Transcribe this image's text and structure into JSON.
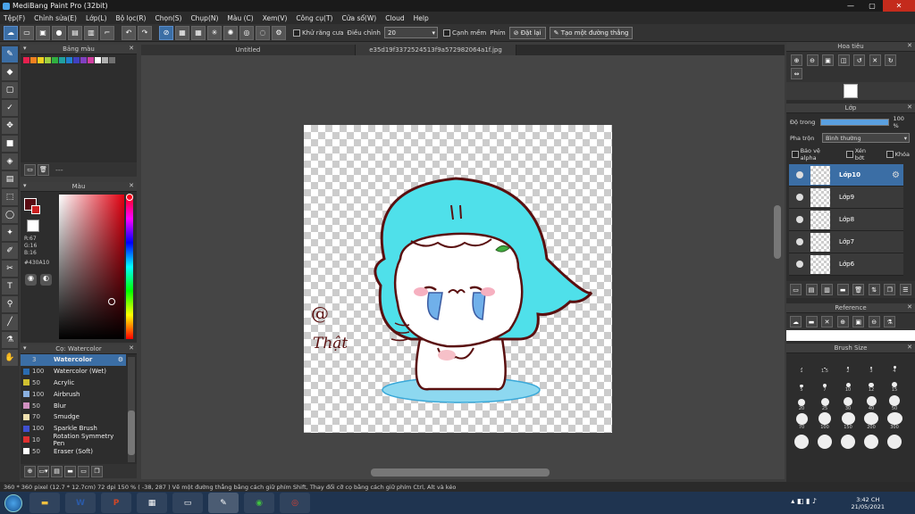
{
  "app": {
    "title": "MediBang Paint Pro (32bit)"
  },
  "menu": [
    "Tệp(F)",
    "Chỉnh sửa(E)",
    "Lớp(L)",
    "Bộ lọc(R)",
    "Chọn(S)",
    "Chụp(N)",
    "Màu (C)",
    "Xem(V)",
    "Công cụ(T)",
    "Cửa sổ(W)",
    "Cloud",
    "Help"
  ],
  "toolbar": {
    "antialias_label": "Khử răng cưa",
    "correction_label": "Điều chỉnh",
    "correction_value": "20",
    "sharp_label": "Cạnh mềm",
    "key_label": "Phím",
    "reset_label": "Đặt lại",
    "make_line_label": "Tạo một đường thẳng"
  },
  "tabs": {
    "tab1": "Untitled",
    "tab2": "e35d19f3372524513f9a572982064a1f.jpg"
  },
  "palette": {
    "title": "Bảng màu",
    "dash": "---",
    "colors": [
      "#e6204e",
      "#f08020",
      "#f0d020",
      "#a0d040",
      "#30b040",
      "#20a0a0",
      "#2080d0",
      "#4040c0",
      "#8040c0",
      "#d040a0",
      "#ffffff",
      "#b0b0b0",
      "#707070"
    ]
  },
  "color": {
    "title": "Màu",
    "r": "R:67",
    "g": "G:16",
    "b": "B:16",
    "hex": "#430A10",
    "primary": "#5a0c12",
    "secondary": "#cc2020"
  },
  "brushes": {
    "title": "Cọ: Watercolor",
    "items": [
      {
        "size": "3",
        "name": "Watercolor",
        "color": "#3b6ea5"
      },
      {
        "size": "100",
        "name": "Watercolor (Wet)",
        "color": "#2a6cb0"
      },
      {
        "size": "50",
        "name": "Acrylic",
        "color": "#d0c030"
      },
      {
        "size": "100",
        "name": "Airbrush",
        "color": "#8ab0e0"
      },
      {
        "size": "50",
        "name": "Blur",
        "color": "#d090c0"
      },
      {
        "size": "70",
        "name": "Smudge",
        "color": "#f0e0b0"
      },
      {
        "size": "100",
        "name": "Sparkle Brush",
        "color": "#4050d0"
      },
      {
        "size": "10",
        "name": "Rotation Symmetry Pen",
        "color": "#e03030"
      },
      {
        "size": "50",
        "name": "Eraser (Soft)",
        "color": "#ffffff"
      }
    ]
  },
  "navigator": {
    "title": "Hoa tiêu"
  },
  "layers": {
    "title": "Lớp",
    "opacity_label": "Độ trong",
    "opacity_value": "100 %",
    "blend_label": "Pha trộn",
    "blend_value": "Bình thường",
    "protect_alpha": "Bảo vệ alpha",
    "clip": "Xén bớt",
    "lock": "Khóa",
    "items": [
      "Lớp10",
      "Lớp9",
      "Lớp8",
      "Lớp7",
      "Lớp6"
    ]
  },
  "reference": {
    "title": "Reference"
  },
  "brushsize": {
    "title": "Brush Size",
    "sizes": [
      "1",
      "1.5",
      "2",
      "3",
      "4",
      "5",
      "7",
      "10",
      "12",
      "15",
      "20",
      "25",
      "30",
      "40",
      "50",
      "70",
      "100",
      "150",
      "200",
      "300",
      "",
      "",
      "",
      "",
      ""
    ]
  },
  "drawing": {
    "signature_line1": "@",
    "signature_line2": "Thật"
  },
  "status": {
    "text": "360 * 360 pixel  (12.7 * 12.7cm)  72 dpi  150 %  ( -38, 287 )  Vẽ một đường thẳng bằng cách giữ phím Shift, Thay đổi cỡ cọ bằng cách giữ phím Ctrl, Alt và kéo"
  },
  "taskbar": {
    "time": "3:42 CH",
    "date": "21/05/2021",
    "apps": [
      "W",
      "P"
    ]
  }
}
